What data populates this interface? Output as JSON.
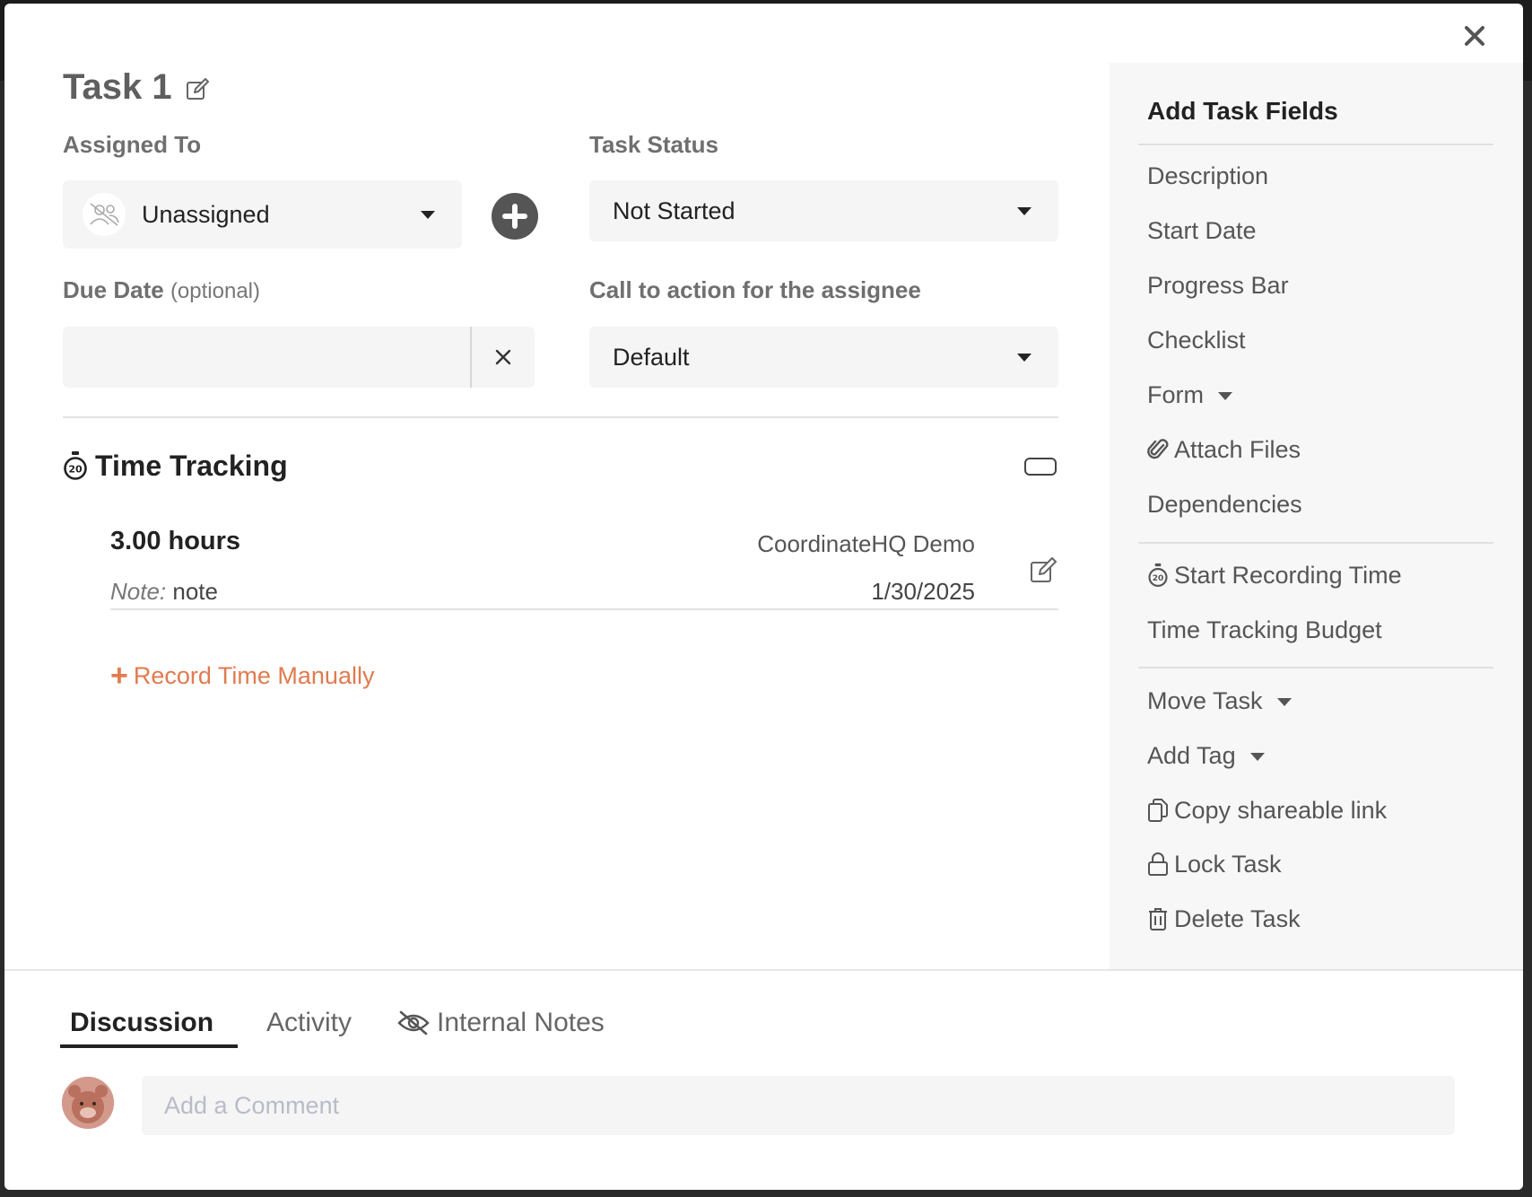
{
  "task": {
    "title": "Task 1"
  },
  "fields": {
    "assigned_to_label": "Assigned To",
    "assigned_to_value": "Unassigned",
    "task_status_label": "Task Status",
    "task_status_value": "Not Started",
    "due_date_label": "Due Date",
    "due_date_optional": "(optional)",
    "due_date_value": "",
    "cta_label": "Call to action for the assignee",
    "cta_value": "Default"
  },
  "time_tracking": {
    "title": "Time Tracking",
    "entries": [
      {
        "hours": "3.00 hours",
        "project": "CoordinateHQ Demo",
        "note_label": "Note:",
        "note": "note",
        "date": "1/30/2025"
      }
    ],
    "record_manually": "Record Time Manually"
  },
  "sidebar": {
    "title": "Add Task Fields",
    "group1": [
      "Description",
      "Start Date",
      "Progress Bar",
      "Checklist",
      "Form",
      "Attach Files",
      "Dependencies"
    ],
    "group2": [
      "Start Recording Time",
      "Time Tracking Budget"
    ],
    "group3": [
      "Move Task",
      "Add Tag",
      "Copy shareable link",
      "Lock Task",
      "Delete Task"
    ]
  },
  "tabs": {
    "discussion": "Discussion",
    "activity": "Activity",
    "internal_notes": "Internal Notes"
  },
  "comment": {
    "placeholder": "Add a Comment"
  },
  "colors": {
    "accent": "#e07b4f",
    "sidebar_bg": "#f7f7f7",
    "field_bg": "#f5f5f5"
  },
  "icons": [
    "close-icon",
    "edit-icon",
    "unassigned-user-icon",
    "plus-circle-icon",
    "clear-icon",
    "stopwatch-icon",
    "toggle-icon",
    "paperclip-icon",
    "copy-icon",
    "lock-icon",
    "trash-icon",
    "eye-slash-icon"
  ]
}
